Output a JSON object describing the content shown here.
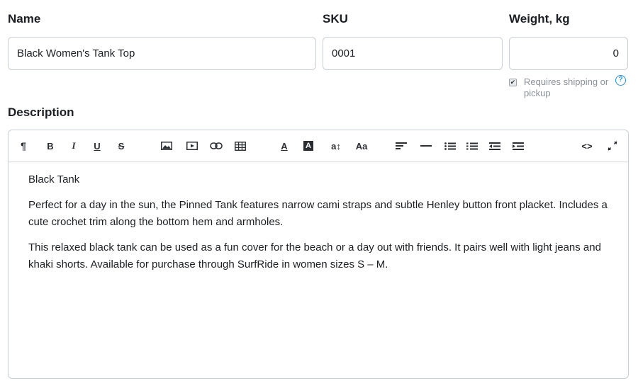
{
  "fields": {
    "name": {
      "label": "Name",
      "value": "Black Women's Tank Top"
    },
    "sku": {
      "label": "SKU",
      "value": "0001"
    },
    "weight": {
      "label": "Weight, kg",
      "value": "0"
    },
    "requires_shipping": {
      "checked": true,
      "label": "Requires shipping or pickup"
    }
  },
  "description": {
    "label": "Description",
    "toolbar": [
      {
        "name": "paragraph-icon",
        "glyph": "¶"
      },
      {
        "name": "bold-icon",
        "glyph": "B"
      },
      {
        "name": "italic-icon",
        "glyph": "I"
      },
      {
        "name": "underline-icon",
        "glyph": "U"
      },
      {
        "name": "strikethrough-icon",
        "glyph": "S"
      },
      {
        "name": "image-icon",
        "glyph": ""
      },
      {
        "name": "video-icon",
        "glyph": ""
      },
      {
        "name": "link-icon",
        "glyph": ""
      },
      {
        "name": "table-icon",
        "glyph": ""
      },
      {
        "name": "text-color-icon",
        "glyph": "A"
      },
      {
        "name": "background-color-icon",
        "glyph": "A"
      },
      {
        "name": "font-size-icon",
        "glyph": "a↕"
      },
      {
        "name": "font-family-icon",
        "glyph": "Aa"
      },
      {
        "name": "align-icon",
        "glyph": ""
      },
      {
        "name": "horizontal-rule-icon",
        "glyph": ""
      },
      {
        "name": "bulleted-list-icon",
        "glyph": ""
      },
      {
        "name": "numbered-list-icon",
        "glyph": ""
      },
      {
        "name": "outdent-icon",
        "glyph": ""
      },
      {
        "name": "indent-icon",
        "glyph": ""
      },
      {
        "name": "code-view-icon",
        "glyph": "<>"
      },
      {
        "name": "fullscreen-icon",
        "glyph": ""
      }
    ],
    "content": {
      "heading": "Black Tank",
      "paragraph1": "Perfect for a day in the sun, the Pinned Tank features narrow cami straps and subtle Henley button front placket. Includes a cute crochet trim along the bottom hem and armholes.",
      "paragraph2": "This relaxed black tank can be used as a fun cover for the beach or a day out with friends. It pairs well with light jeans and khaki shorts. Available for purchase through SurfRide in women sizes S – M."
    }
  },
  "colors": {
    "border": "#c9cfd6",
    "help_accent": "#2d8fdc",
    "muted_text": "#8a9199"
  }
}
